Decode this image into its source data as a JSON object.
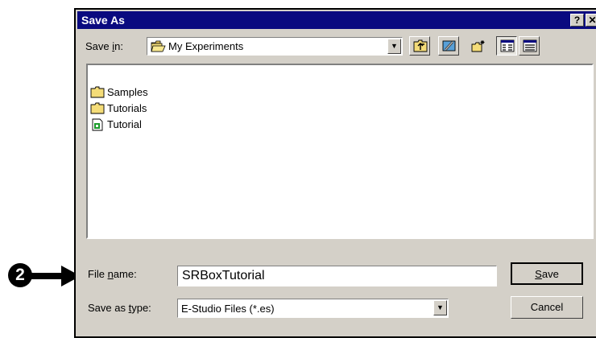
{
  "dialog": {
    "title": "Save As",
    "help_glyph": "?",
    "close_glyph": "✕"
  },
  "save_in": {
    "label_pre": "Save ",
    "label_accel": "i",
    "label_post": "n:",
    "value": "My Experiments",
    "icon": "open-folder-icon"
  },
  "toolbar": [
    {
      "name": "up-one-level-button",
      "icon": "folder-up-icon"
    },
    {
      "name": "desktop-button",
      "icon": "desktop-icon"
    },
    {
      "name": "new-folder-button",
      "icon": "new-folder-icon"
    },
    {
      "name": "list-view-button",
      "icon": "list-view-icon"
    },
    {
      "name": "details-view-button",
      "icon": "details-view-icon"
    }
  ],
  "files": [
    {
      "name": "Samples",
      "type": "folder"
    },
    {
      "name": "Tutorials",
      "type": "folder"
    },
    {
      "name": "Tutorial",
      "type": "document"
    }
  ],
  "file_name": {
    "label_pre": "File ",
    "label_accel": "n",
    "label_post": "ame:",
    "value": "SRBoxTutorial"
  },
  "save_type": {
    "label_pre": "Save as ",
    "label_accel": "t",
    "label_post": "ype:",
    "value": "E-Studio Files (*.es)"
  },
  "buttons": {
    "save_accel": "S",
    "save_rest": "ave",
    "cancel": "Cancel"
  },
  "callout": {
    "number": "2"
  }
}
